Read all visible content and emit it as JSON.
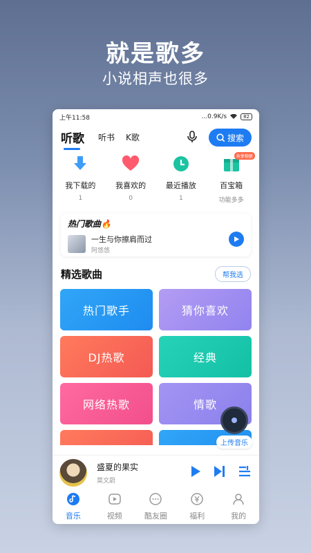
{
  "promo": {
    "title": "就是歌多",
    "subtitle": "小说相声也很多"
  },
  "status": {
    "time": "上午11:58",
    "speed": "...0.9K/s",
    "battery": "82"
  },
  "header": {
    "tabs": [
      "听歌",
      "听书",
      "K歌"
    ],
    "search_label": "搜索"
  },
  "quick": [
    {
      "label": "我下载的",
      "sub": "1",
      "icon": "download-icon",
      "color": "#3d9df7"
    },
    {
      "label": "我喜欢的",
      "sub": "0",
      "icon": "heart-icon",
      "color": "#ff5a6e"
    },
    {
      "label": "最近播放",
      "sub": "1",
      "icon": "clock-icon",
      "color": "#1bc3a1"
    },
    {
      "label": "百宝箱",
      "sub": "功能多多",
      "icon": "gift-box-icon",
      "color": "#1bc3a1",
      "badge": "共享相册"
    }
  ],
  "hot": {
    "title": "热门歌曲🔥",
    "song": "一生与你擦肩而过",
    "artist": "阿悠悠"
  },
  "featured": {
    "title": "精选歌曲",
    "help_label": "帮我选",
    "tiles": [
      "热门歌手",
      "猜你喜欢",
      "DJ热歌",
      "经典",
      "网络热歌",
      "情歌",
      "",
      ""
    ]
  },
  "upload": {
    "label": "上传音乐"
  },
  "player": {
    "song": "盛夏的果实",
    "artist": "莫文蔚"
  },
  "bottomnav": {
    "items": [
      {
        "label": "音乐",
        "icon": "music-note-icon",
        "active": true
      },
      {
        "label": "视频",
        "icon": "video-icon",
        "active": false
      },
      {
        "label": "酷友圈",
        "icon": "chat-bubble-icon",
        "active": false
      },
      {
        "label": "福利",
        "icon": "coin-icon",
        "active": false
      },
      {
        "label": "我的",
        "icon": "profile-icon",
        "active": false
      }
    ]
  },
  "colors": {
    "accent": "#1e7cf2"
  }
}
